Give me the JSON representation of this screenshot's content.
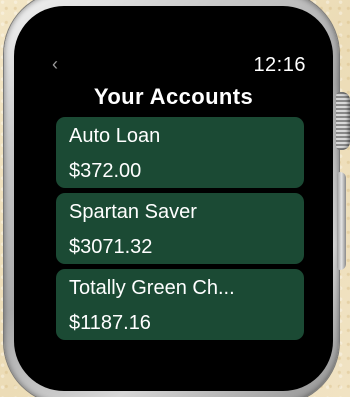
{
  "status_bar": {
    "back_glyph": "‹",
    "time": "12:16"
  },
  "title": "Your Accounts",
  "accounts": [
    {
      "name": "Auto Loan",
      "balance": "$372.00"
    },
    {
      "name": "Spartan Saver",
      "balance": "$3071.32"
    },
    {
      "name": "Totally Green Ch...",
      "balance": "$1187.16"
    }
  ],
  "colors": {
    "card_background": "#1b4a34",
    "screen_background": "#000000",
    "text": "#ffffff"
  },
  "icons": {
    "back": "chevron-left-icon"
  }
}
